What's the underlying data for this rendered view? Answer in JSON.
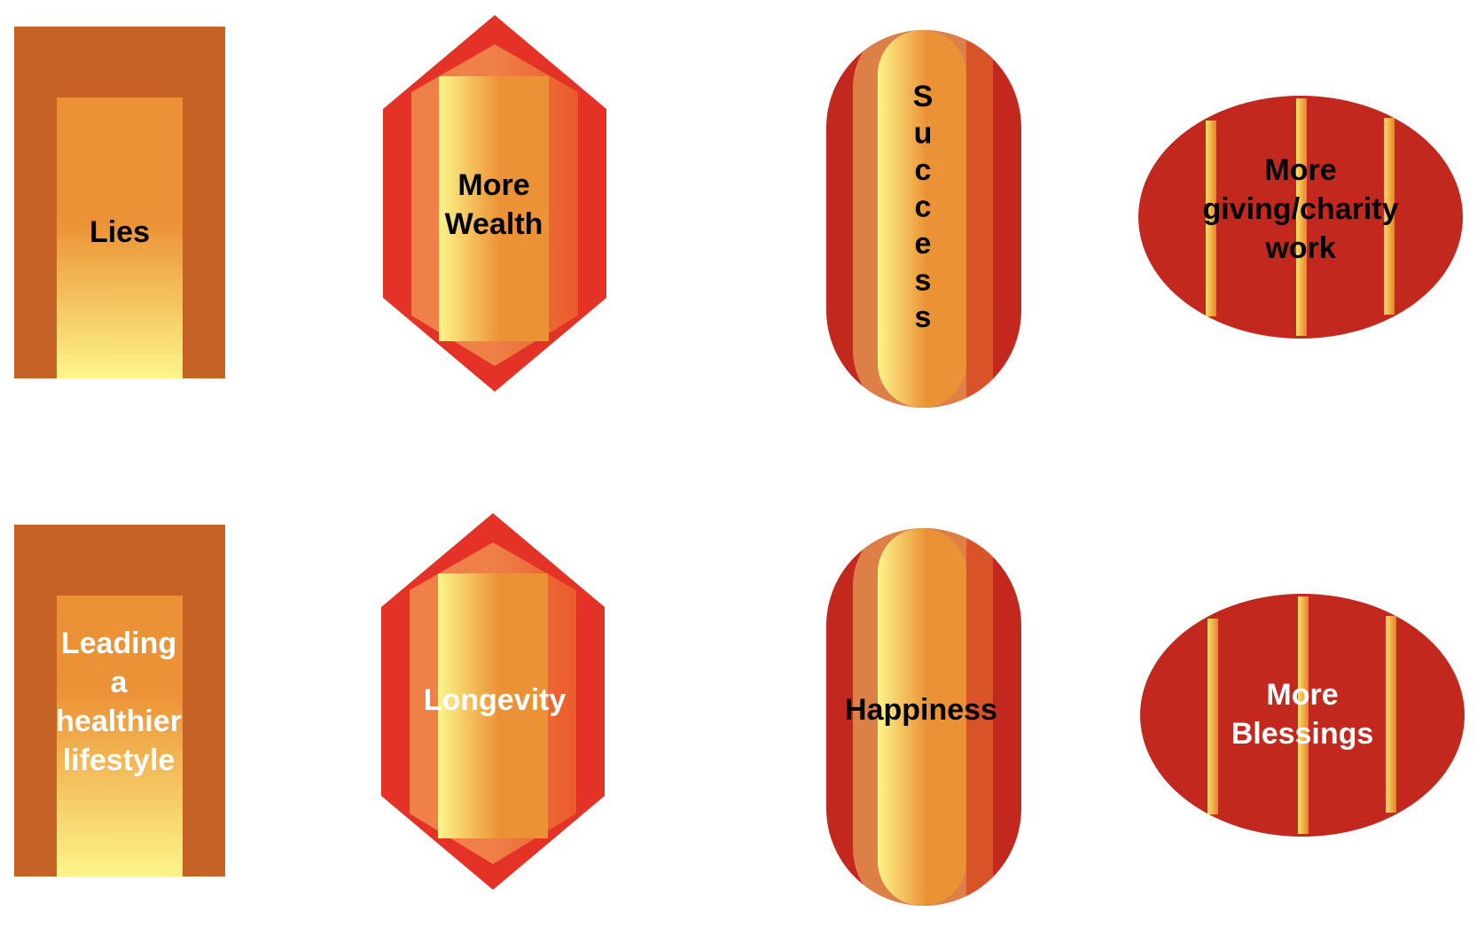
{
  "colors": {
    "rect_outer": "#C66226",
    "orange": "#EC9236",
    "pale_yellow": "#FCF58A",
    "red": "#E43226",
    "red_mid": "#EB5A2A",
    "orange_light": "#EE8048",
    "crimson": "#C3281E",
    "tan": "#DC8048"
  },
  "shapes": [
    {
      "name": "Lies",
      "lines": [
        "Lies"
      ],
      "text_color": "dark"
    },
    {
      "name": "More Wealth",
      "lines": [
        "More",
        "Wealth"
      ],
      "text_color": "dark"
    },
    {
      "name": "Success",
      "lines": [
        "S",
        "u",
        "c",
        "c",
        "e",
        "s",
        "s"
      ],
      "text_color": "dark"
    },
    {
      "name": "More giving/charity work",
      "lines": [
        "More",
        "giving/charity",
        "work"
      ],
      "text_color": "dark"
    },
    {
      "name": "Leading a healthier lifestyle",
      "lines": [
        "Leading",
        "a",
        "healthier",
        "lifestyle"
      ],
      "text_color": "light"
    },
    {
      "name": "Longevity",
      "lines": [
        "Longevity"
      ],
      "text_color": "light"
    },
    {
      "name": "Happiness",
      "lines": [
        "Happiness"
      ],
      "text_color": "dark"
    },
    {
      "name": "More Blessings",
      "lines": [
        "More",
        "Blessings"
      ],
      "text_color": "light"
    }
  ]
}
